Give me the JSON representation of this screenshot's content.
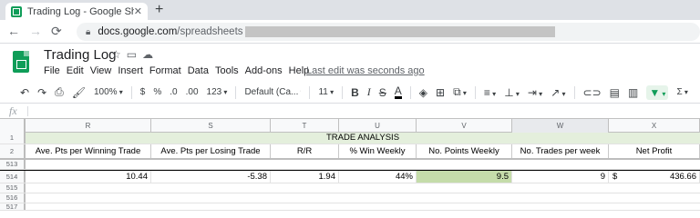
{
  "browser": {
    "tab_title": "Trading Log - Google Sheets",
    "tab_close": "✕",
    "new_tab": "+",
    "url_host": "docs.google.com",
    "url_path": "/spreadsheets"
  },
  "app": {
    "doc_title": "Trading Log",
    "menu": [
      "File",
      "Edit",
      "View",
      "Insert",
      "Format",
      "Data",
      "Tools",
      "Add-ons",
      "Help"
    ],
    "last_edit": "Last edit was seconds ago"
  },
  "toolbar": {
    "zoom": "100%",
    "currency": "$",
    "percent": "%",
    "dec_less": ".0",
    "dec_more": ".00",
    "more_formats": "123",
    "font": "Default (Ca...",
    "font_size": "11",
    "bold": "B",
    "italic": "I",
    "strike": "S",
    "text_color": "A",
    "sigma": "Σ"
  },
  "formula_bar": {
    "fx": "fx"
  },
  "grid": {
    "columns": [
      {
        "letter": "R",
        "selected": false
      },
      {
        "letter": "S",
        "selected": false
      },
      {
        "letter": "T",
        "selected": false
      },
      {
        "letter": "U",
        "selected": false
      },
      {
        "letter": "V",
        "selected": false
      },
      {
        "letter": "W",
        "selected": true
      },
      {
        "letter": "X",
        "selected": false
      }
    ],
    "rows": {
      "row1_num": "1",
      "row1_header": "TRADE ANALYSIS",
      "row2_num": "2",
      "row2_headers": [
        "Ave. Pts per Winning Trade",
        "Ave. Pts per Losing Trade",
        "R/R",
        "% Win Weekly",
        "No. Points Weekly",
        "No. Trades per week",
        "Net Profit"
      ],
      "row513_num": "513",
      "row514_num": "514",
      "row514_values": [
        "10.44",
        "-5.38",
        "1.94",
        "44%",
        "9.5",
        "9",
        "436.66"
      ],
      "currency_symbol": "$",
      "row515_num": "515",
      "row516_num": "516",
      "row517_num": "517"
    },
    "highlight_color": "#c5dcaa",
    "header_band_color": "#e4efdc"
  }
}
